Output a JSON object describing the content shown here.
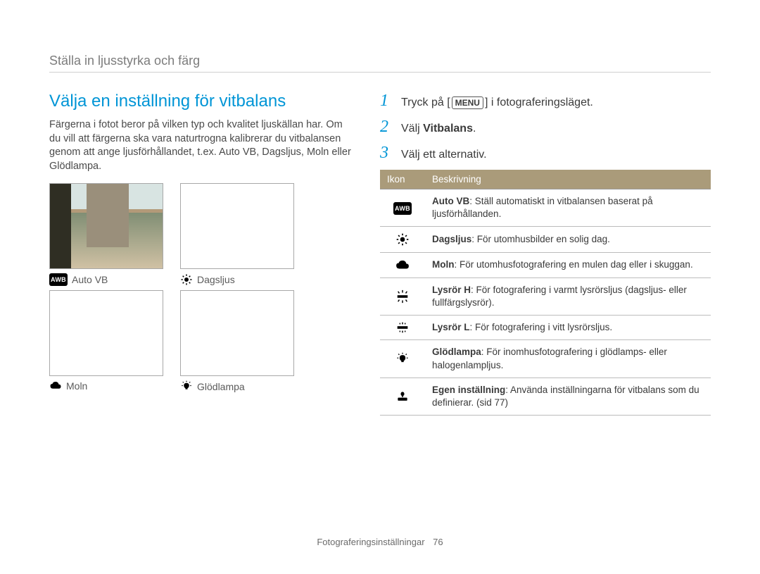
{
  "breadcrumb": "Ställa in ljusstyrka och färg",
  "section_title": "Välja en inställning för vitbalans",
  "intro": "Färgerna i fotot beror på vilken typ och kvalitet ljuskällan har. Om du vill att färgerna ska vara naturtrogna kalibrerar du vitbalansen genom att ange ljusförhållandet, t.ex. Auto VB, Dagsljus, Moln eller Glödlampa.",
  "wb_examples": [
    {
      "label": "Auto VB",
      "icon": "awb"
    },
    {
      "label": "Dagsljus",
      "icon": "sun"
    },
    {
      "label": "Moln",
      "icon": "cloud"
    },
    {
      "label": "Glödlampa",
      "icon": "bulb"
    }
  ],
  "steps": [
    {
      "num": "1",
      "pre": "Tryck på [",
      "menu": "MENU",
      "post": "] i fotograferingsläget."
    },
    {
      "num": "2",
      "text_pre": "Välj ",
      "text_bold": "Vitbalans",
      "text_post": "."
    },
    {
      "num": "3",
      "text": "Välj ett alternativ."
    }
  ],
  "table": {
    "headers": [
      "Ikon",
      "Beskrivning"
    ],
    "rows": [
      {
        "icon": "awb",
        "bold": "Auto VB",
        "text": ": Ställ automatiskt in vitbalansen baserat på ljusförhållanden."
      },
      {
        "icon": "sun",
        "bold": "Dagsljus",
        "text": ": För utomhusbilder en solig dag."
      },
      {
        "icon": "cloud",
        "bold": "Moln",
        "text": ": För utomhusfotografering en mulen dag eller i skuggan."
      },
      {
        "icon": "fluor_h",
        "bold": "Lysrör H",
        "text": ": För fotografering i varmt lysrörsljus (dagsljus- eller fullfärgslysrör)."
      },
      {
        "icon": "fluor_l",
        "bold": "Lysrör L",
        "text": ": För fotografering i vitt lysrörsljus."
      },
      {
        "icon": "bulb",
        "bold": "Glödlampa",
        "text": ": För inomhusfotografering i glödlamps- eller halogenlampljus."
      },
      {
        "icon": "custom",
        "bold": "Egen inställning",
        "text": ": Använda inställningarna för vitbalans som du definierar. (sid 77)"
      }
    ]
  },
  "footer": {
    "section": "Fotograferingsinställningar",
    "page": "76"
  },
  "icon_badge": "AWB"
}
